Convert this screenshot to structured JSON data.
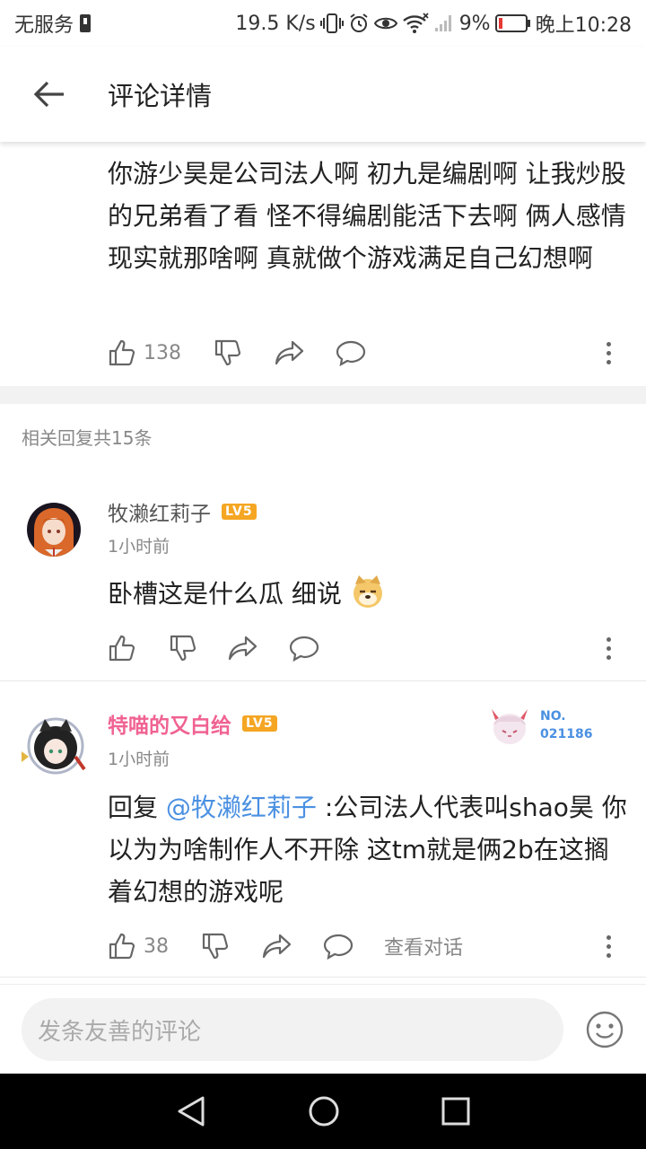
{
  "status_bar": {
    "carrier": "无服务",
    "net_speed": "19.5 K/s",
    "battery_pct": "9%",
    "time": "晚上10:28"
  },
  "app_bar": {
    "title": "评论详情"
  },
  "main_comment": {
    "text": "你游少昊是公司法人啊   初九是编剧啊   让我炒股的兄弟看了看  怪不得编剧能活下去啊   俩人感情现实就那啥啊  真就做个游戏满足自己幻想啊",
    "likes": "138"
  },
  "replies_header": "相关回复共15条",
  "replies": [
    {
      "username": "牧濑红莉子",
      "level": "LV5",
      "time": "1小时前",
      "text": "卧槽这是什么瓜 细说"
    },
    {
      "username": "特喵的又白给",
      "level": "LV5",
      "time": "1小时前",
      "reply_prefix": "回复 ",
      "mention": "@牧濑红莉子",
      "text": " :公司法人代表叫shao昊  你以为为啥制作人不开除   这tm就是俩2b在这搁着幻想的游戏呢",
      "likes": "38",
      "view_dialog": "查看对话",
      "badge_label": "NO.",
      "badge_number": "021186"
    }
  ],
  "input_bar": {
    "placeholder": "发条友善的评论"
  },
  "colors": {
    "mention": "#4a90e2",
    "vip_name": "#f06292",
    "level_badge": "#f5a623"
  }
}
